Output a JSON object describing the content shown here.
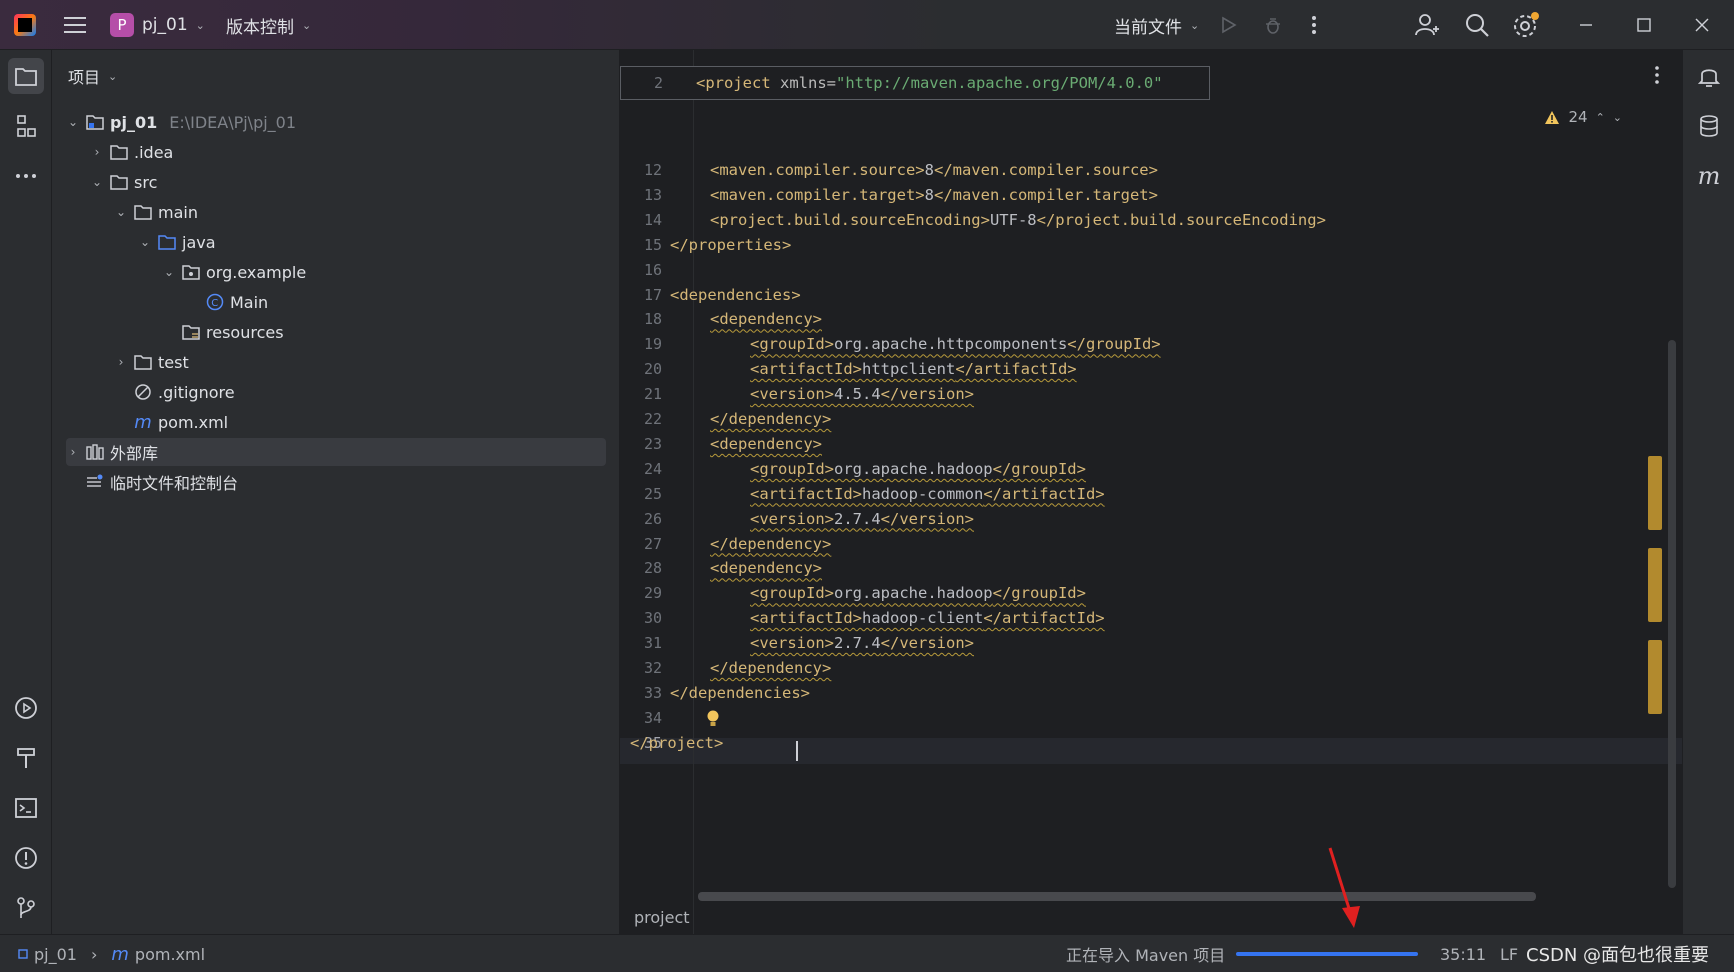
{
  "titlebar": {
    "project_badge": "P",
    "project_name": "pj_01",
    "vcs_label": "版本控制",
    "run_config": "当前文件"
  },
  "project_panel": {
    "title": "项目",
    "tree": [
      {
        "label": "pj_01",
        "path": "E:\\IDEA\\Pj\\pj_01",
        "arrow": "⌄",
        "icon": "module-folder-icon"
      },
      {
        "label": ".idea",
        "arrow": "›",
        "icon": "folder-icon"
      },
      {
        "label": "src",
        "arrow": "⌄",
        "icon": "folder-icon"
      },
      {
        "label": "main",
        "arrow": "⌄",
        "icon": "folder-icon"
      },
      {
        "label": "java",
        "arrow": "⌄",
        "icon": "source-folder-icon"
      },
      {
        "label": "org.example",
        "arrow": "⌄",
        "icon": "package-icon"
      },
      {
        "label": "Main",
        "arrow": "",
        "icon": "class-icon"
      },
      {
        "label": "resources",
        "arrow": "",
        "icon": "resources-folder-icon"
      },
      {
        "label": "test",
        "arrow": "›",
        "icon": "folder-icon"
      },
      {
        "label": ".gitignore",
        "arrow": "",
        "icon": "gitignore-icon"
      },
      {
        "label": "pom.xml",
        "arrow": "",
        "icon": "maven-icon"
      },
      {
        "label": "外部库",
        "arrow": "›",
        "icon": "library-icon"
      },
      {
        "label": "临时文件和控制台",
        "arrow": "",
        "icon": "scratches-icon"
      }
    ]
  },
  "editor": {
    "sticky_line_number": "2",
    "sticky_tag_open": "<project",
    "sticky_attr": " xmlns=",
    "sticky_value": "\"http://maven.apache.org/POM/4.0.0\"",
    "warnings_count": "24",
    "line_numbers": [
      "12",
      "13",
      "14",
      "15",
      "16",
      "17",
      "18",
      "19",
      "20",
      "21",
      "22",
      "23",
      "24",
      "25",
      "26",
      "27",
      "28",
      "29",
      "30",
      "31",
      "32",
      "33",
      "34",
      "35"
    ],
    "lines": [
      {
        "indent": 2,
        "t1": "<maven.compiler.source>",
        "v": "8",
        "t2": "</maven.compiler.source>",
        "wavy": false
      },
      {
        "indent": 2,
        "t1": "<maven.compiler.target>",
        "v": "8",
        "t2": "</maven.compiler.target>",
        "wavy": false
      },
      {
        "indent": 2,
        "t1": "<project.build.sourceEncoding>",
        "v": "UTF-8",
        "t2": "</project.build.sourceEncoding>",
        "wavy": false
      },
      {
        "indent": 1,
        "t1": "</properties>",
        "v": "",
        "t2": "",
        "wavy": false
      },
      {
        "indent": 0,
        "t1": "",
        "v": "",
        "t2": "",
        "wavy": false
      },
      {
        "indent": 1,
        "t1": "<dependencies>",
        "v": "",
        "t2": "",
        "wavy": false
      },
      {
        "indent": 2,
        "t1": "<dependency>",
        "v": "",
        "t2": "",
        "wavy": true
      },
      {
        "indent": 3,
        "t1": "<groupId>",
        "v": "org.apache.httpcomponents",
        "t2": "</groupId>",
        "wavy": true
      },
      {
        "indent": 3,
        "t1": "<artifactId>",
        "v": "httpclient",
        "t2": "</artifactId>",
        "wavy": true
      },
      {
        "indent": 3,
        "t1": "<version>",
        "v": "4.5.4",
        "t2": "</version>",
        "wavy": true
      },
      {
        "indent": 2,
        "t1": "</dependency>",
        "v": "",
        "t2": "",
        "wavy": true
      },
      {
        "indent": 2,
        "t1": "<dependency>",
        "v": "",
        "t2": "",
        "wavy": true
      },
      {
        "indent": 3,
        "t1": "<groupId>",
        "v": "org.apache.hadoop",
        "t2": "</groupId>",
        "wavy": true
      },
      {
        "indent": 3,
        "t1": "<artifactId>",
        "v": "hadoop-common",
        "t2": "</artifactId>",
        "wavy": true
      },
      {
        "indent": 3,
        "t1": "<version>",
        "v": "2.7.4",
        "t2": "</version>",
        "wavy": true
      },
      {
        "indent": 2,
        "t1": "</dependency>",
        "v": "",
        "t2": "",
        "wavy": true
      },
      {
        "indent": 2,
        "t1": "<dependency>",
        "v": "",
        "t2": "",
        "wavy": true
      },
      {
        "indent": 3,
        "t1": "<groupId>",
        "v": "org.apache.hadoop",
        "t2": "</groupId>",
        "wavy": true
      },
      {
        "indent": 3,
        "t1": "<artifactId>",
        "v": "hadoop-client",
        "t2": "</artifactId>",
        "wavy": true
      },
      {
        "indent": 3,
        "t1": "<version>",
        "v": "2.7.4",
        "t2": "</version>",
        "wavy": true
      },
      {
        "indent": 2,
        "t1": "</dependency>",
        "v": "",
        "t2": "",
        "wavy": true
      },
      {
        "indent": 1,
        "t1": "</dependencies>",
        "v": "",
        "t2": "",
        "wavy": false
      },
      {
        "indent": 0,
        "t1": "",
        "v": "",
        "t2": "",
        "wavy": false
      },
      {
        "indent": 0,
        "t1": "</project>",
        "v": "",
        "t2": "",
        "wavy": false
      }
    ],
    "breadcrumb": "project"
  },
  "statusbar": {
    "crumb_project": "pj_01",
    "crumb_file": "pom.xml",
    "task_text": "正在导入 Maven 项目",
    "position": "35:11",
    "line_separator": "LF",
    "watermark": "CSDN @面包也很重要"
  },
  "colors": {
    "accent": "#3574f0",
    "tag": "#d5b778",
    "string": "#6aab73",
    "warning": "#b28a2e",
    "arrow_annotation": "#e02020"
  }
}
